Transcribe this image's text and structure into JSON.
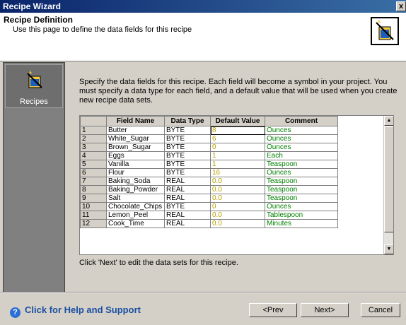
{
  "window": {
    "title": "Recipe Wizard",
    "close_glyph": "x"
  },
  "header": {
    "title": "Recipe Definition",
    "subtitle": "Use this page to define the data fields for this recipe"
  },
  "sidebar": {
    "items": [
      {
        "label": "Recipes",
        "icon": "recipe-icon"
      }
    ]
  },
  "main": {
    "description": "Specify the data fields for this recipe. Each field will become a symbol in your project. You must specify a data type for each field, and a default value that will be used when you create new recipe data sets.",
    "hint": "Click 'Next' to edit the data sets for this recipe.",
    "table": {
      "columns": [
        "",
        "Field Name",
        "Data Type",
        "Default Value",
        "Comment"
      ],
      "rows": [
        [
          "1",
          "Butter",
          "BYTE",
          "8",
          "Ounces"
        ],
        [
          "2",
          "White_Sugar",
          "BYTE",
          "6",
          "Ounces"
        ],
        [
          "3",
          "Brown_Sugar",
          "BYTE",
          "0",
          "Ounces"
        ],
        [
          "4",
          "Eggs",
          "BYTE",
          "1",
          "Each"
        ],
        [
          "5",
          "Vanilla",
          "BYTE",
          "1",
          "Teaspoon"
        ],
        [
          "6",
          "Flour",
          "BYTE",
          "16",
          "Ounces"
        ],
        [
          "7",
          "Baking_Soda",
          "REAL",
          "0.0",
          "Teaspoon"
        ],
        [
          "8",
          "Baking_Powder",
          "REAL",
          "0.0",
          "Teaspoon"
        ],
        [
          "9",
          "Salt",
          "REAL",
          "0.0",
          "Teaspoon"
        ],
        [
          "10",
          "Chocolate_Chips",
          "BYTE",
          "0",
          "Ounces"
        ],
        [
          "11",
          "Lemon_Peel",
          "REAL",
          "0.0",
          "Tablespoon"
        ],
        [
          "12",
          "Cook_Time",
          "REAL",
          "0.0",
          "Minutes"
        ]
      ]
    }
  },
  "footer": {
    "help": "Click for Help and Support",
    "prev": "<Prev",
    "next": "Next>",
    "cancel": "Cancel"
  },
  "colors": {
    "default_value_text": "#b8a000",
    "comment_text": "#008000",
    "title_bar": "#0a246a"
  }
}
